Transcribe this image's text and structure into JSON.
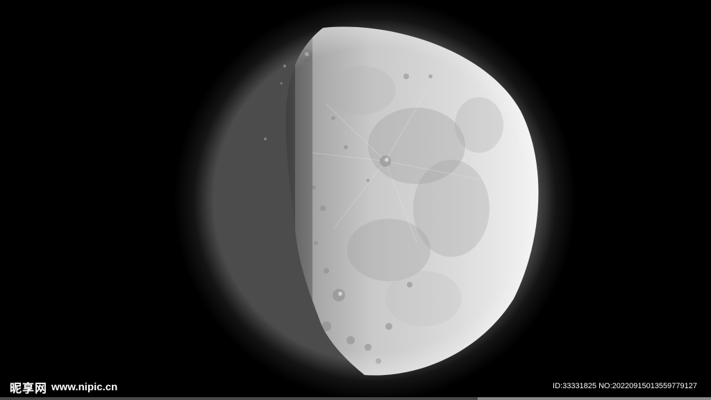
{
  "scene": {
    "subject": "moon",
    "background_color": "#000000",
    "moon_lit_color": "#e4e4e4",
    "moon_shadow_color": "#8c8c8c"
  },
  "watermark": {
    "logo_text": "昵享网",
    "site_url": "www.nipic.cn",
    "id_text": "ID:33331825 NO:20220915013559779127"
  }
}
